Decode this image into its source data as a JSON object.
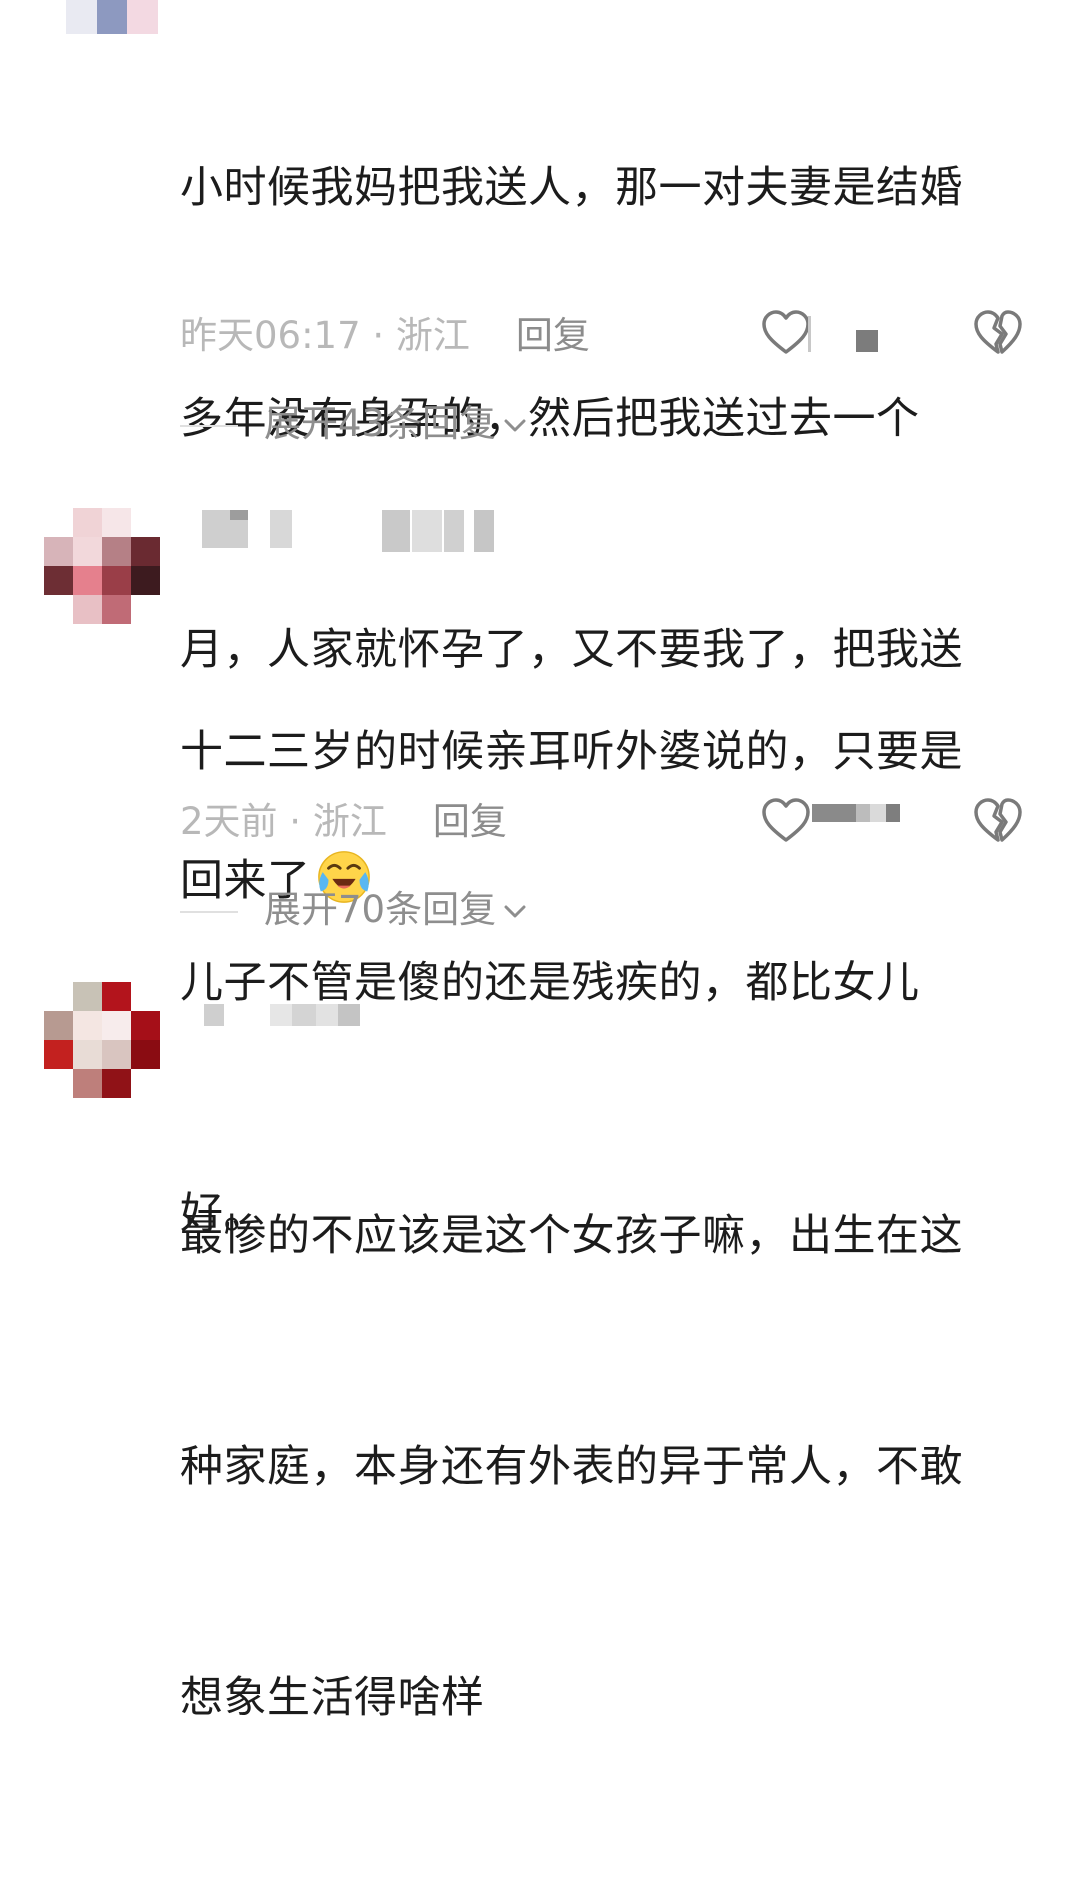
{
  "comments": [
    {
      "text": "小时候我妈把我送人，那一对夫妻是结婚多年没有身孕的，然后把我送过去一个月，人家就怀孕了，又不要我了，把我送回来了",
      "line1": "小时候我妈把我送人，那一对夫妻是结婚",
      "line2": "多年没有身孕的，然后把我送过去一个",
      "line3": "月，人家就怀孕了，又不要我了，把我送",
      "line4": "回来了",
      "emoji": "crying-laughing-emoji",
      "meta": "昨天06:17 · 浙江",
      "reply_label": "回复",
      "expand_label": "展开43条回复"
    },
    {
      "line1": "十二三岁的时候亲耳听外婆说的，只要是",
      "line2": "儿子不管是傻的还是残疾的，都比女儿",
      "line3": "好。",
      "meta": "2天前 · 浙江",
      "reply_label": "回复",
      "expand_label": "展开70条回复"
    },
    {
      "line1": "最惨的不应该是这个女孩子嘛，出生在这",
      "line2": "种家庭，本身还有外表的异于常人，不敢",
      "line3": "想象生活得啥样"
    }
  ],
  "icons": {
    "like": "heart-outline-icon",
    "dislike": "broken-heart-icon",
    "expand": "chevron-down-icon"
  },
  "colors": {
    "text": "#1c1c1c",
    "meta": "#b8b8b8",
    "reply": "#8c8c8c",
    "icon": "#7a7a7a"
  }
}
